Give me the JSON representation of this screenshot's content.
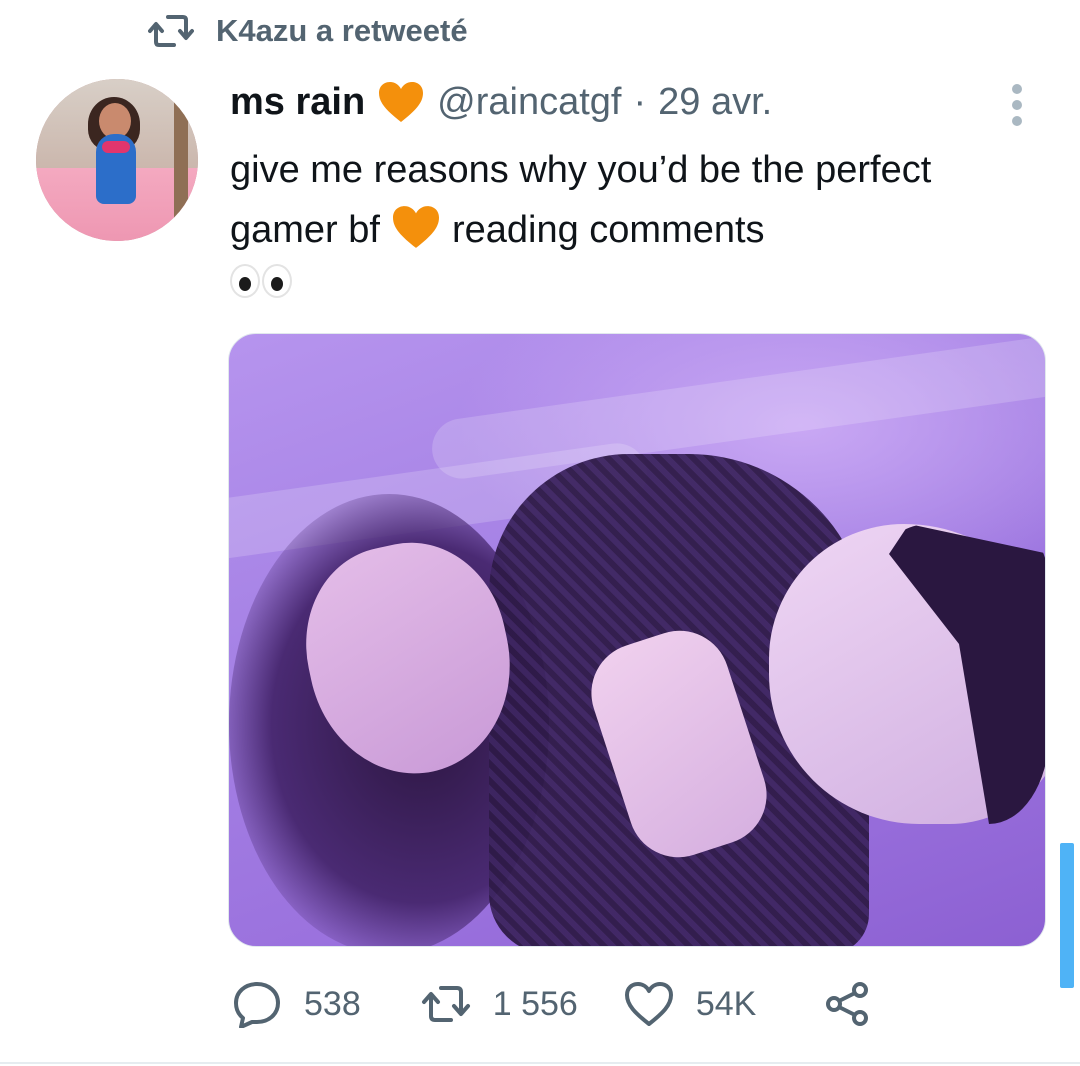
{
  "retweet_banner": {
    "text": "K4azu a retweeté"
  },
  "tweet": {
    "display_name": "ms rain",
    "handle": "@raincatgf",
    "separator": "·",
    "date": "29 avr.",
    "text_part1": "give me reasons why you’d be the perfect gamer bf",
    "text_part2": "reading comments",
    "emoji_heart_color": "#F4900C"
  },
  "actions": {
    "reply_count": "538",
    "retweet_count": "1 556",
    "like_count": "54K"
  },
  "colors": {
    "text_primary": "#0f1419",
    "text_secondary": "#536471",
    "accent_blue": "#4fb3f6",
    "heart_orange": "#F4900C"
  },
  "icons": [
    "retweet-icon",
    "orange-heart-icon",
    "more-options-icon",
    "eyes-emoji-icon",
    "reply-icon",
    "like-icon",
    "share-icon"
  ]
}
